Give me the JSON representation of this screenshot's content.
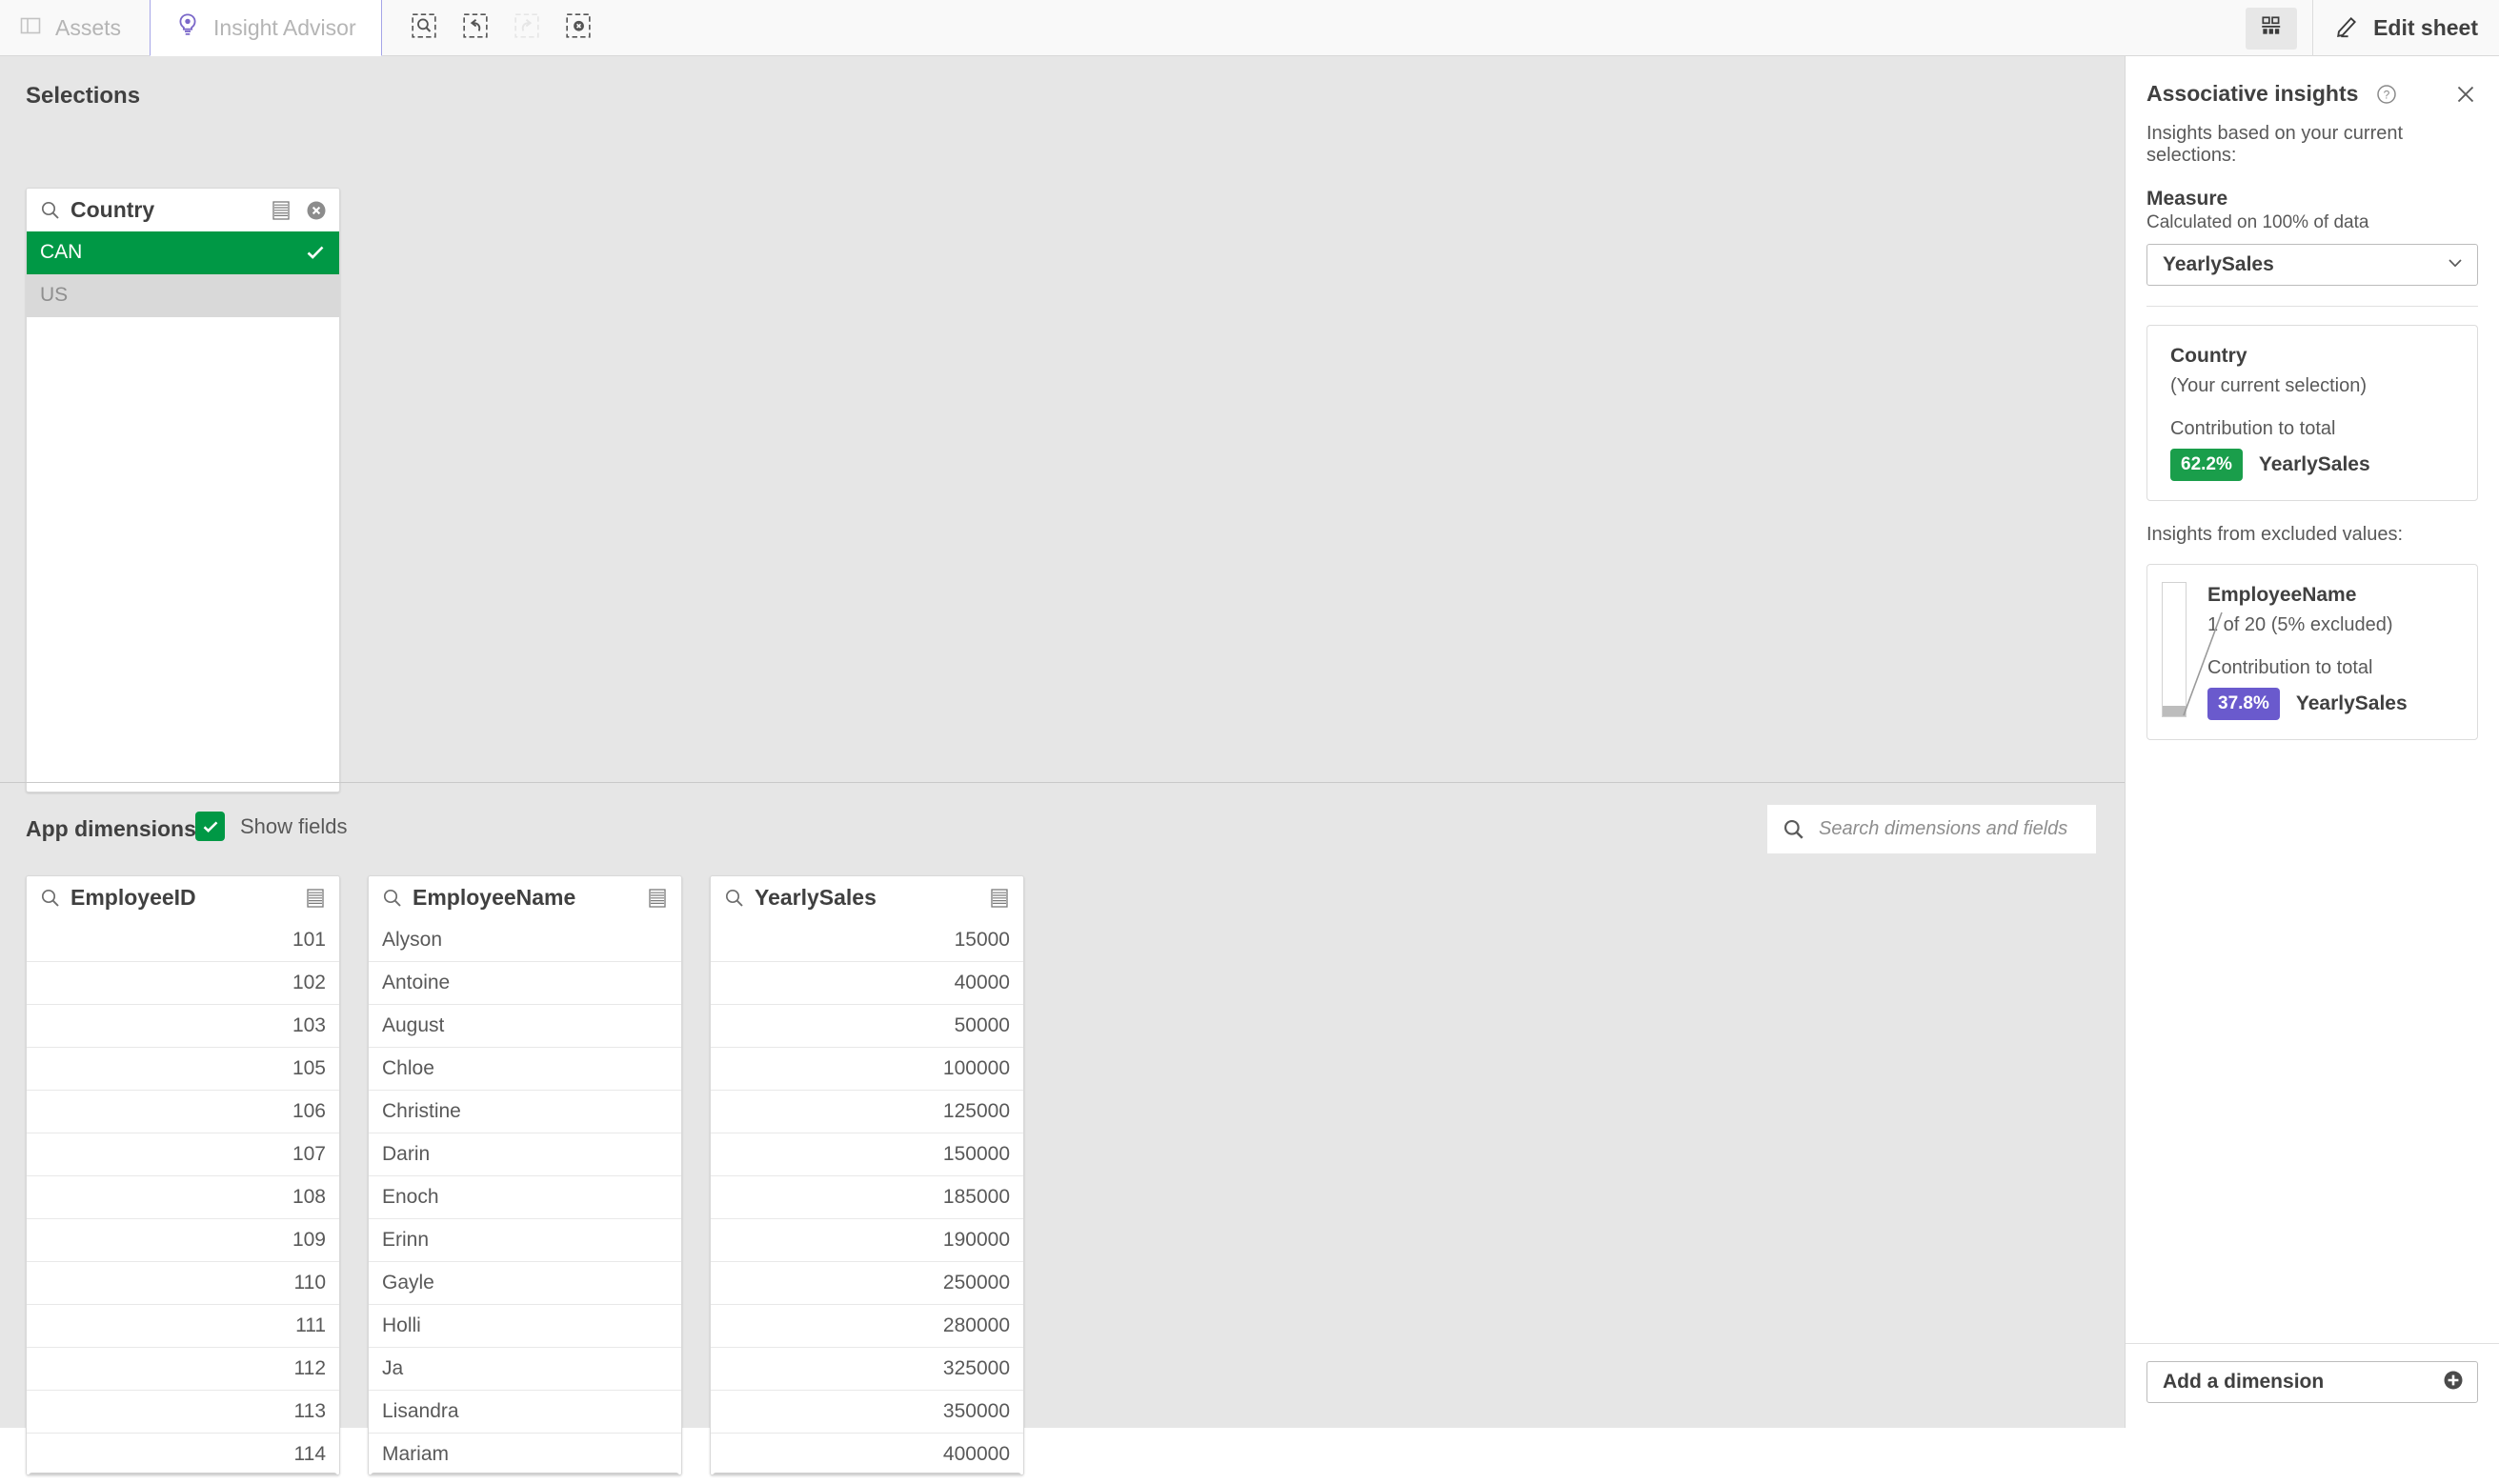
{
  "toolbar": {
    "tabs": [
      {
        "label": "Assets",
        "icon": "panel-icon",
        "active": false
      },
      {
        "label": "Insight Advisor",
        "icon": "insight-advisor-icon",
        "active": true
      }
    ],
    "selection_tools": [
      {
        "name": "selection-search-icon",
        "enabled": true
      },
      {
        "name": "step-back-icon",
        "enabled": true
      },
      {
        "name": "step-forward-icon",
        "enabled": false
      },
      {
        "name": "clear-all-selections-icon",
        "enabled": true
      }
    ],
    "sheet_icon": "sheet-grid-icon",
    "edit_label": "Edit sheet",
    "edit_icon": "pencil-icon"
  },
  "selections": {
    "title": "Selections",
    "listbox": {
      "field": "Country",
      "search_icon": "search-icon",
      "menu_icon": "listbox-menu-icon",
      "clear_icon": "clear-selection-icon",
      "rows": [
        {
          "value": "CAN",
          "state": "selected"
        },
        {
          "value": "US",
          "state": "excluded"
        }
      ]
    }
  },
  "app_dimensions": {
    "label": "App dimensions",
    "show_fields": {
      "label": "Show fields",
      "checked": true,
      "color": "#009845"
    },
    "search": {
      "placeholder": "Search dimensions and fields",
      "value": "",
      "icon": "search-icon"
    },
    "fields": [
      {
        "name": "EmployeeID",
        "align": "right",
        "values": [
          "101",
          "102",
          "103",
          "105",
          "106",
          "107",
          "108",
          "109",
          "110",
          "111",
          "112",
          "113",
          "114"
        ]
      },
      {
        "name": "EmployeeName",
        "align": "left",
        "values": [
          "Alyson",
          "Antoine",
          "August",
          "Chloe",
          "Christine",
          "Darin",
          "Enoch",
          "Erinn",
          "Gayle",
          "Holli",
          "Ja",
          "Lisandra",
          "Mariam"
        ]
      },
      {
        "name": "YearlySales",
        "align": "right",
        "values": [
          "15000",
          "40000",
          "50000",
          "100000",
          "125000",
          "150000",
          "185000",
          "190000",
          "250000",
          "280000",
          "325000",
          "350000",
          "400000"
        ]
      }
    ]
  },
  "associative_insights": {
    "title": "Associative insights",
    "help_icon": "help-circle-icon",
    "close_icon": "close-icon",
    "subtitle": "Insights based on your current selections:",
    "measure_label": "Measure",
    "measure_note": "Calculated on 100% of data",
    "measure_value": "YearlySales",
    "measure_chevron": "chevron-down-icon",
    "selection_card": {
      "dimension": "Country",
      "note": "(Your current selection)",
      "contribution_label": "Contribution to total",
      "percent": "62.2%",
      "measure": "YearlySales",
      "badge_color": "#1a9e4b"
    },
    "excluded_label": "Insights from excluded values:",
    "excluded_card": {
      "dimension": "EmployeeName",
      "note": "1 of 20 (5% excluded)",
      "contribution_label": "Contribution to total",
      "percent": "37.8%",
      "measure": "YearlySales",
      "badge_color": "#6a5acd"
    },
    "add_dimension": {
      "label": "Add a dimension",
      "icon": "add-circle-icon"
    }
  }
}
